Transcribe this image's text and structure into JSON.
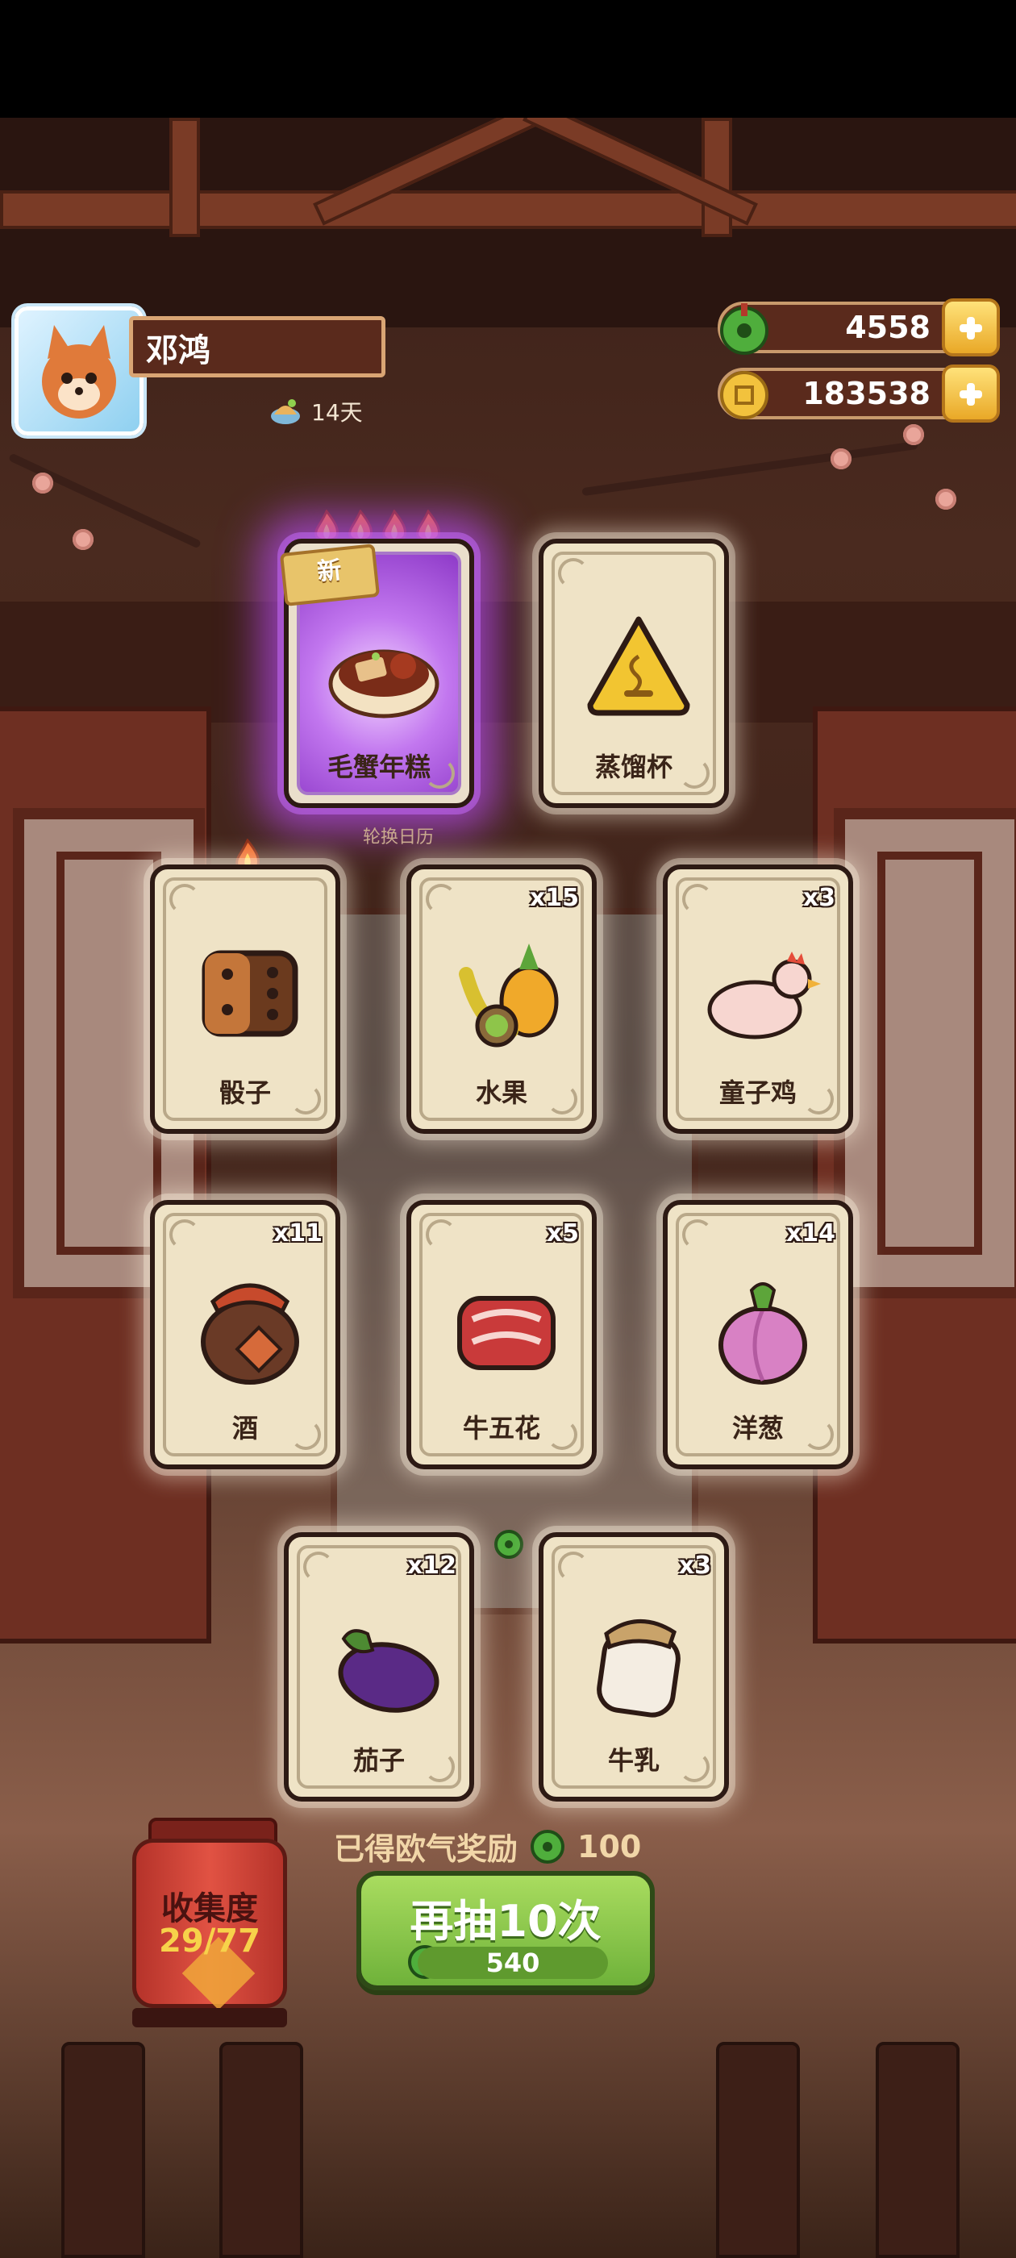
{
  "player": {
    "name": "邓鸿",
    "days": "14天"
  },
  "currency": {
    "jade": "4558",
    "coins": "183538"
  },
  "new_badge": "新",
  "calendar_text": "轮换日历",
  "cards": [
    {
      "name": "毛蟹年糕",
      "count": "",
      "rare": true
    },
    {
      "name": "蒸馏杯",
      "count": ""
    },
    {
      "name": "骰子",
      "count": ""
    },
    {
      "name": "水果",
      "count": "x15"
    },
    {
      "name": "童子鸡",
      "count": "x3"
    },
    {
      "name": "酒",
      "count": "x11"
    },
    {
      "name": "牛五花",
      "count": "x5"
    },
    {
      "name": "洋葱",
      "count": "x14"
    },
    {
      "name": "茄子",
      "count": "x12"
    },
    {
      "name": "牛乳",
      "count": "x3"
    }
  ],
  "luck": {
    "label": "已得欧气奖励",
    "value": "100"
  },
  "redraw": {
    "label": "再抽10次",
    "cost": "540"
  },
  "collection": {
    "label": "收集度",
    "progress": "29/77"
  },
  "colors": {
    "rare_glow": "#b04ae6",
    "button_green": "#7fc043",
    "panel_brown": "#5a2a1c"
  }
}
